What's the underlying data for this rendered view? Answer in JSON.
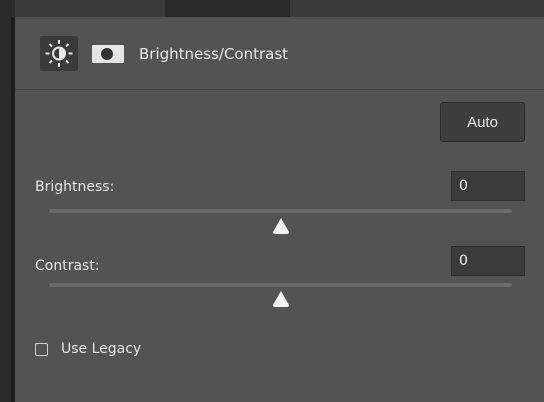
{
  "header": {
    "title": "Brightness/Contrast",
    "adjustment_icon": "brightness-sun-icon",
    "mask_icon": "layer-mask-icon"
  },
  "controls": {
    "auto_label": "Auto",
    "brightness": {
      "label": "Brightness:",
      "value": "0",
      "slider_fraction": 0.5
    },
    "contrast": {
      "label": "Contrast:",
      "value": "0",
      "slider_fraction": 0.5
    },
    "use_legacy": {
      "label": "Use Legacy",
      "checked": false
    }
  },
  "colors": {
    "panel_bg": "#535353",
    "icon_highlight": "#3a3a3a",
    "text": "#e8e8e8"
  }
}
